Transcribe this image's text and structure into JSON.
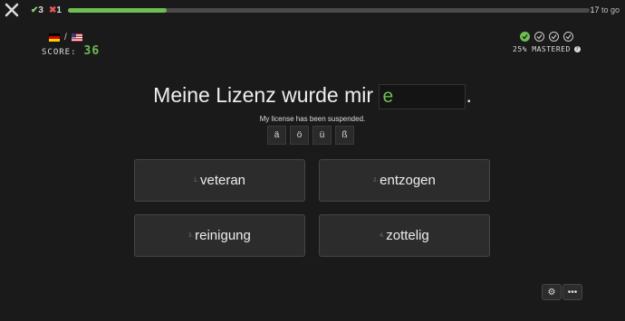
{
  "header": {
    "correct_count": "3",
    "wrong_count": "1",
    "progress_fraction": 0.19,
    "remaining_count": "17",
    "remaining_label": "to go"
  },
  "player": {
    "source_flag": "german-flag",
    "target_flag": "us-flag",
    "score_label": "SCORE:",
    "score_value": "36"
  },
  "mastery": {
    "circles": [
      "mastered",
      "pending",
      "pending",
      "pending"
    ],
    "label": "25% MASTERED"
  },
  "question": {
    "before": "Meine Lizenz wurde mir",
    "answer_value": "e",
    "after": ".",
    "translation": "My license has been suspended."
  },
  "special_chars": [
    "ä",
    "ö",
    "ü",
    "ß"
  ],
  "choices": [
    {
      "num": "1.",
      "text": "veteran"
    },
    {
      "num": "2.",
      "text": "entzogen"
    },
    {
      "num": "3.",
      "text": "reinigung"
    },
    {
      "num": "4.",
      "text": "zottelig"
    }
  ],
  "tools": {
    "settings_icon": "gear-icon",
    "more_icon": "more-icon"
  },
  "colors": {
    "accent": "#6dbd52",
    "background": "#1a1a1a",
    "wrong": "#e05a5a"
  }
}
